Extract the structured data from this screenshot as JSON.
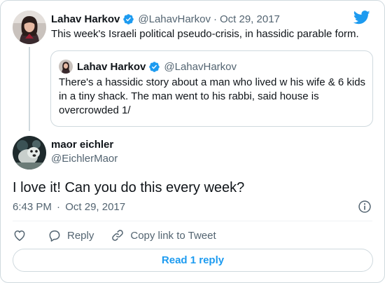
{
  "parent_tweet": {
    "author_name": "Lahav Harkov",
    "author_handle": "@LahavHarkov",
    "separator": "·",
    "date": "Oct 29, 2017",
    "text": "This week's Israeli political pseudo-crisis, in hassidic parable form.",
    "verified": true,
    "avatar_icon": "woman-dark-hair-avatar"
  },
  "quoted_tweet": {
    "author_name": "Lahav Harkov",
    "author_handle": "@LahavHarkov",
    "text": "There's a hassidic story about a man who lived w his wife & 6 kids in a tiny shack. The man went to his rabbi, said house is overcrowded 1/",
    "verified": true
  },
  "reply_tweet": {
    "author_name": "maor eichler",
    "author_handle": "@EichlerMaor",
    "text": "I love it! Can you do this every week?",
    "time": "6:43 PM",
    "separator": "·",
    "date": "Oct 29, 2017",
    "avatar_icon": "dog-photo-avatar"
  },
  "actions": {
    "like_icon": "heart-icon",
    "reply_label": "Reply",
    "reply_icon": "speech-bubble-icon",
    "copy_link_label": "Copy link to Tweet",
    "copy_link_icon": "link-icon"
  },
  "read_replies_label": "Read 1 reply",
  "colors": {
    "brand_blue": "#1d9bf0",
    "text_primary": "#0f1419",
    "text_secondary": "#536471",
    "border": "#cfd9de"
  }
}
